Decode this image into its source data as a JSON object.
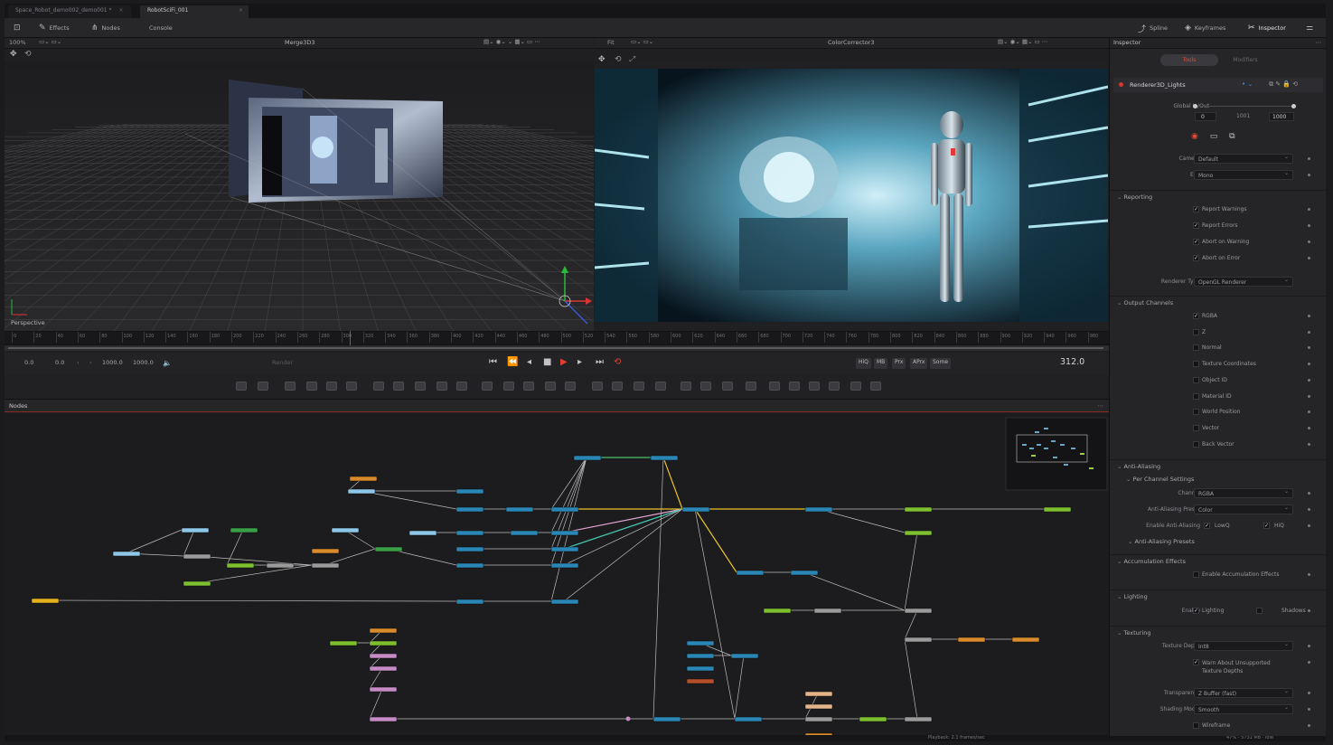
{
  "tabs": [
    {
      "label": "Space_Robot_demo002_demo001 *"
    },
    {
      "label": "RobotSciFi_001"
    }
  ],
  "toolbar": {
    "effects": "Effects",
    "nodes": "Nodes",
    "console": "Console",
    "spline": "Spline",
    "keyframes": "Keyframes",
    "inspector": "Inspector"
  },
  "viewer_left": {
    "zoom": "100%",
    "title": "Merge3D3",
    "camera_label": "Perspective"
  },
  "viewer_right": {
    "fit": "Fit",
    "title": "ColorCorrector3"
  },
  "ruler_ticks": [
    "0",
    "20",
    "40",
    "60",
    "80",
    "100",
    "120",
    "140",
    "160",
    "180",
    "200",
    "220",
    "240",
    "260",
    "280",
    "300",
    "320",
    "340",
    "360",
    "380",
    "400",
    "420",
    "440",
    "460",
    "480",
    "500",
    "520",
    "540",
    "560",
    "580",
    "600",
    "620",
    "640",
    "660",
    "680",
    "700",
    "720",
    "740",
    "760",
    "780",
    "800",
    "820",
    "840",
    "860",
    "880",
    "900",
    "920",
    "940",
    "960",
    "980"
  ],
  "transport": {
    "start": "0.0",
    "in": "0.0",
    "out": "1000.0",
    "end": "1000.0",
    "render": "Render",
    "quality_buttons": [
      "HiQ",
      "MB",
      "Prx",
      "APrx",
      "Some"
    ],
    "current_frame": "312.0"
  },
  "nodes_panel": {
    "title": "Nodes"
  },
  "status": {
    "playback": "Playback: 2.1 frames/sec",
    "memory": "47% - 5731 MB  ·  Idle"
  },
  "inspector": {
    "title": "Inspector",
    "tab_tools": "Tools",
    "tab_modifiers": "Modifiers",
    "node_name": "Renderer3D_Lights",
    "global_inout_label": "Global In/Out",
    "global_in": "0",
    "global_mid": "1001",
    "global_out": "1000",
    "camera_label": "Camera",
    "camera_value": "Default",
    "eye_label": "Eye",
    "eye_value": "Mono",
    "reporting": "Reporting",
    "report_items": [
      "Report Warnings",
      "Report Errors",
      "Abort on Warning",
      "Abort on Error"
    ],
    "renderer_type_label": "Renderer Type",
    "renderer_type_value": "OpenGL Renderer",
    "output_channels": "Output Channels",
    "channel_items": [
      {
        "label": "RGBA",
        "checked": true
      },
      {
        "label": "Z",
        "checked": false
      },
      {
        "label": "Normal",
        "checked": false
      },
      {
        "label": "Texture Coordinates",
        "checked": false
      },
      {
        "label": "Object ID",
        "checked": false
      },
      {
        "label": "Material ID",
        "checked": false
      },
      {
        "label": "World Position",
        "checked": false
      },
      {
        "label": "Vector",
        "checked": false
      },
      {
        "label": "Back Vector",
        "checked": false
      }
    ],
    "anti_aliasing": "Anti-Aliasing",
    "per_channel": "Per Channel Settings",
    "channel_label": "Channel",
    "channel_value": "RGBA",
    "aa_preset_label": "Anti-Aliasing Preset",
    "aa_preset_value": "Color",
    "enable_aa_label": "Enable Anti-Aliasing",
    "lowq": "LowQ",
    "hiq": "HiQ",
    "aa_presets": "Anti-Aliasing Presets",
    "accum": "Accumulation Effects",
    "enable_accum": "Enable Accumulation Effects",
    "lighting": "Lighting",
    "enable_label": "Enable",
    "lighting_cb": "Lighting",
    "shadows_cb": "Shadows",
    "texturing": "Texturing",
    "tex_depth_label": "Texture Depth",
    "tex_depth_value": "Int8",
    "warn_unsupported": "Warn About Unsupported Texture Depths",
    "transparency_label": "Transparency",
    "transparency_value": "Z Buffer (fast)",
    "shading_label": "Shading Model",
    "shading_value": "Smooth",
    "wireframe": "Wireframe"
  },
  "colors": {
    "node_blue": "#2a86b5",
    "node_lightblue": "#8ec6e8",
    "node_green": "#7dbf2e",
    "node_darkgreen": "#3aa048",
    "node_orange": "#d98a2b",
    "node_yellow": "#e8b21e",
    "node_gray": "#9a9a9a",
    "node_pink": "#c68ac6",
    "node_peach": "#e3b48a",
    "node_red": "#b5502a",
    "accent_red": "#d23a2e"
  }
}
